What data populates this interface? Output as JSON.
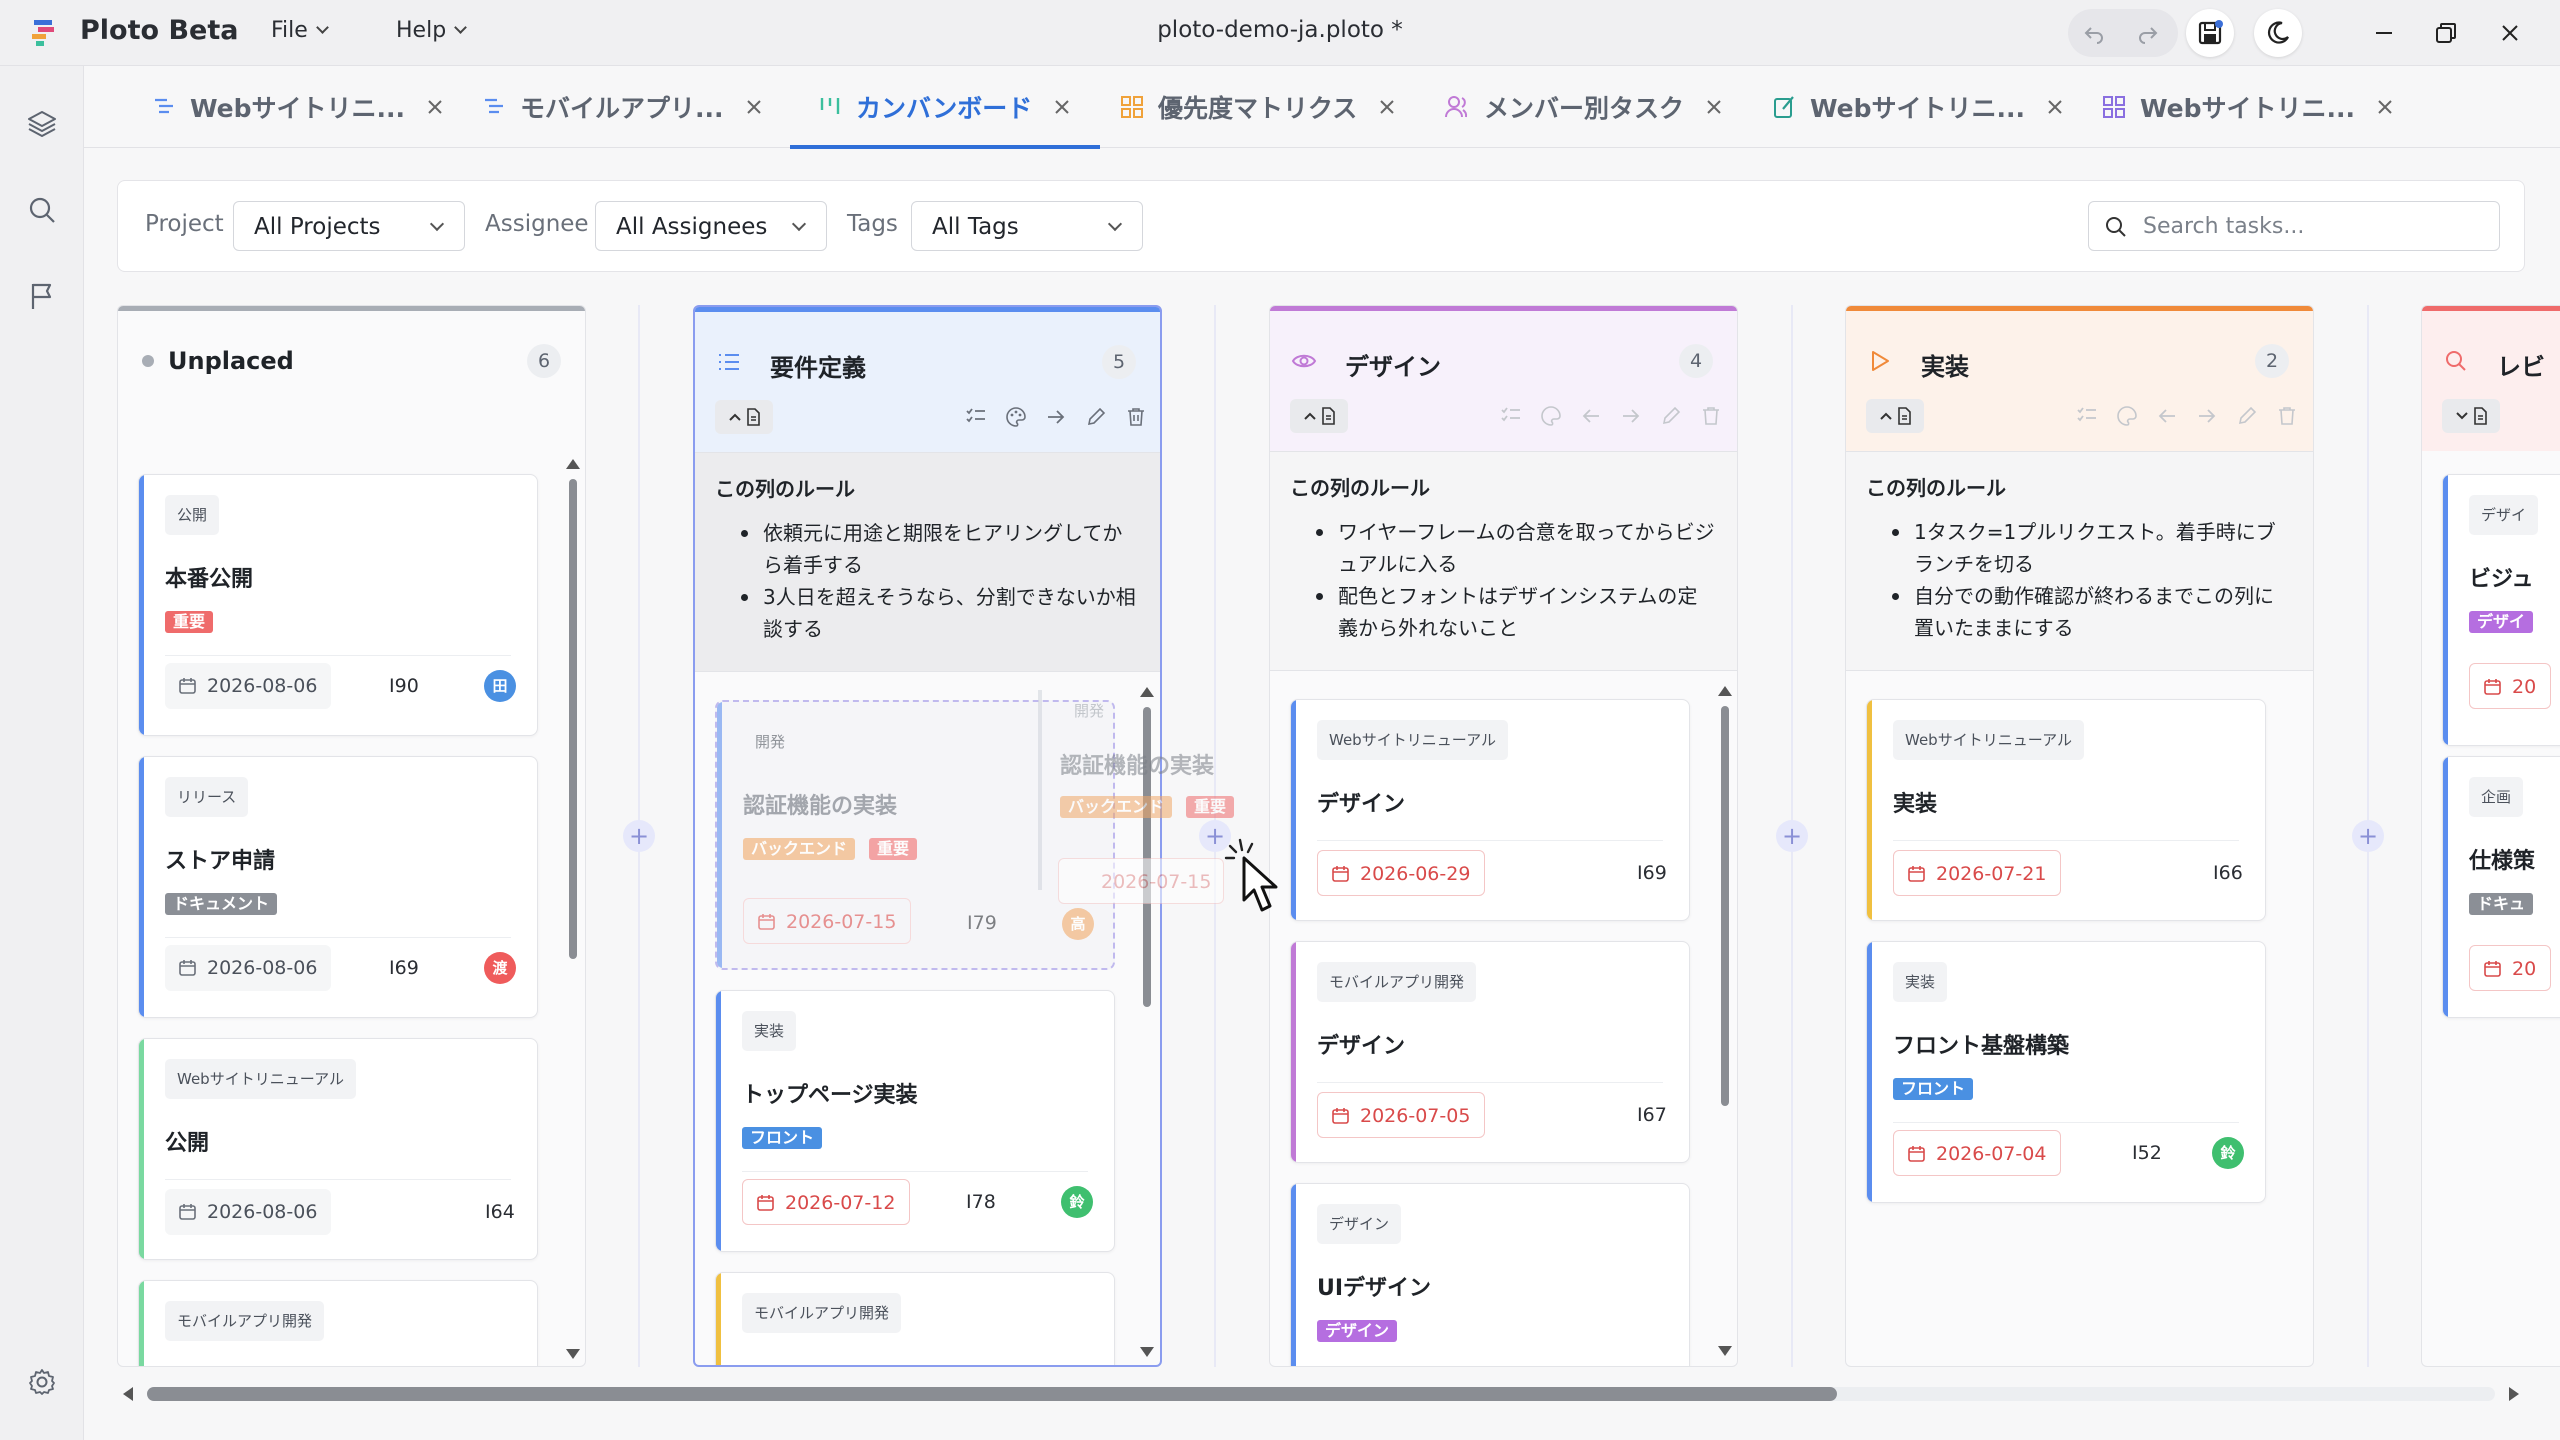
{
  "app": {
    "name": "Ploto Beta",
    "menus": [
      "File",
      "Help"
    ],
    "document_title": "ploto-demo-ja.ploto *"
  },
  "tabs": [
    {
      "label": "Webサイトリニ...",
      "icon": "list-icon",
      "color": "#5b8def"
    },
    {
      "label": "モバイルアプリ...",
      "icon": "list-icon",
      "color": "#5b8def"
    },
    {
      "label": "カンバンボード",
      "icon": "kanban-icon",
      "color": "#3bbf9d",
      "active": true
    },
    {
      "label": "優先度マトリクス",
      "icon": "grid-icon",
      "color": "#f0a23a"
    },
    {
      "label": "メンバー別タスク",
      "icon": "people-icon",
      "color": "#c07ad6"
    },
    {
      "label": "Webサイトリニ...",
      "icon": "edit-doc-icon",
      "color": "#2a9d8f"
    },
    {
      "label": "Webサイトリニ...",
      "icon": "grid-icon",
      "color": "#8a6fe0"
    }
  ],
  "filters": {
    "project_label": "Project",
    "project_value": "All Projects",
    "assignee_label": "Assignee",
    "assignee_value": "All Assignees",
    "tags_label": "Tags",
    "tags_value": "All Tags",
    "search_placeholder": "Search tasks..."
  },
  "columns": [
    {
      "title": "Unplaced",
      "count": "6",
      "accent": "#a8adb5",
      "cards": [
        {
          "project": "公開",
          "title": "本番公開",
          "tags": [
            {
              "label": "重要",
              "color": "#ef6b6b"
            }
          ],
          "date": "2026-08-06",
          "ticket": "I90",
          "avatar": "田",
          "avatar_color": "#4a90e2",
          "bar": "#5b8def"
        },
        {
          "project": "リリース",
          "title": "ストア申請",
          "tags": [
            {
              "label": "ドキュメント",
              "color": "#8b8f96"
            }
          ],
          "date": "2026-08-06",
          "ticket": "I69",
          "avatar": "渡",
          "avatar_color": "#ef5b5b",
          "bar": "#5b8def"
        },
        {
          "project": "Webサイトリニューアル",
          "title": "公開",
          "tags": [],
          "date": "2026-08-06",
          "ticket": "I64",
          "bar": "#7ad9a0"
        },
        {
          "project": "モバイルアプリ開発",
          "title": "",
          "tags": [],
          "bar": "#7ad9a0"
        }
      ]
    },
    {
      "title": "要件定義",
      "count": "5",
      "accent": "#5b8def",
      "rules_heading": "この列のルール",
      "rules": [
        "依頼元に用途と期限をヒアリングしてから着手する",
        "3人日を超えそうなら、分割できないか相談する"
      ],
      "cards": [
        {
          "project": "開発",
          "title": "認証機能の実装",
          "tags": [
            {
              "label": "バックエンド",
              "color": "#f0a868"
            },
            {
              "label": "重要",
              "color": "#ef6b6b"
            }
          ],
          "date": "2026-07-15",
          "ticket": "I79",
          "avatar": "高",
          "avatar_color": "#f0a868",
          "placeholder": true
        },
        {
          "project": "実装",
          "title": "トップページ実装",
          "tags": [
            {
              "label": "フロント",
              "color": "#4a90e2"
            }
          ],
          "date": "2026-07-12",
          "ticket": "I78",
          "avatar": "鈴",
          "avatar_color": "#3fbf6f",
          "bar": "#5b8def"
        },
        {
          "project": "モバイルアプリ開発",
          "title": "",
          "tags": [],
          "bar": "#f0c040"
        }
      ]
    },
    {
      "title": "デザイン",
      "count": "4",
      "accent": "#c07ad6",
      "rules_heading": "この列のルール",
      "rules": [
        "ワイヤーフレームの合意を取ってからビジュアルに入る",
        "配色とフォントはデザインシステムの定義から外れないこと"
      ],
      "cards": [
        {
          "project": "Webサイトリニューアル",
          "title": "デザイン",
          "tags": [],
          "date": "2026-06-29",
          "ticket": "I69",
          "bar": "#5b8def"
        },
        {
          "project": "モバイルアプリ開発",
          "title": "デザイン",
          "tags": [],
          "date": "2026-07-05",
          "ticket": "I67",
          "bar": "#c07ad6"
        },
        {
          "project": "デザイン",
          "title": "UIデザイン",
          "tags": [
            {
              "label": "デザイン",
              "color": "#b56ee0"
            }
          ],
          "bar": "#5b8def"
        }
      ]
    },
    {
      "title": "実装",
      "count": "2",
      "accent": "#f08a3a",
      "rules_heading": "この列のルール",
      "rules": [
        "1タスク=1プルリクエスト。着手時にブランチを切る",
        "自分での動作確認が終わるまでこの列に置いたままにする"
      ],
      "cards": [
        {
          "project": "Webサイトリニューアル",
          "title": "実装",
          "tags": [],
          "date": "2026-07-21",
          "ticket": "I66",
          "bar": "#f0c040"
        },
        {
          "project": "実装",
          "title": "フロント基盤構築",
          "tags": [
            {
              "label": "フロント",
              "color": "#4a90e2"
            }
          ],
          "date": "2026-07-04",
          "ticket": "I52",
          "avatar": "鈴",
          "avatar_color": "#3fbf6f",
          "bar": "#5b8def"
        }
      ]
    },
    {
      "title": "レビ",
      "accent": "#ef6b6b",
      "cards": [
        {
          "project": "デザイ",
          "title": "ビジュ",
          "tags": [
            {
              "label": "デザイ",
              "color": "#b56ee0"
            }
          ],
          "date": "20",
          "bar": "#5b8def"
        },
        {
          "project": "企画",
          "title": "仕様策",
          "tags": [
            {
              "label": "ドキュ",
              "color": "#8b8f96"
            }
          ],
          "date": "20",
          "bar": "#5b8def"
        }
      ]
    }
  ],
  "drag_ghost": {
    "project": "開発",
    "title": "認証機能の実装",
    "tags": [
      {
        "label": "バックエンド",
        "color": "#f0a868"
      },
      {
        "label": "重要",
        "color": "#ef6b6b"
      }
    ],
    "date": "2026-07-15"
  }
}
